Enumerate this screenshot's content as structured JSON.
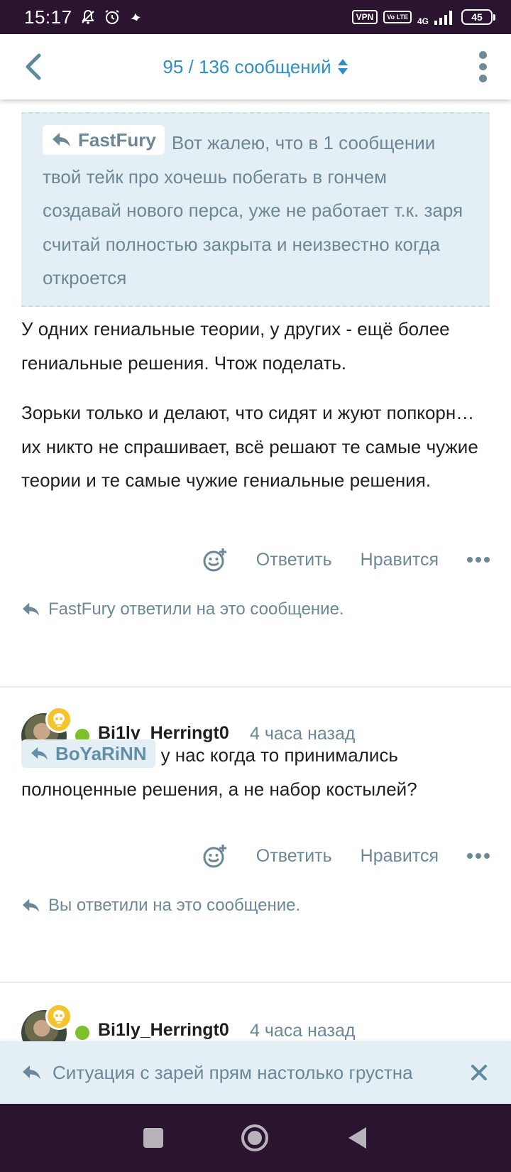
{
  "status_bar": {
    "time": "15:17",
    "vpn": "VPN",
    "volte": "Vo LTE",
    "network": "4G",
    "battery": "45"
  },
  "header": {
    "title": "95 / 136 сообщений"
  },
  "quote": {
    "author": "FastFury",
    "text": "Вот жалею, что в 1 сообщении твой тейк про хочешь побегать в гончем создавай нового перса, уже не работает т.к. заря считай полностью закрыта и неизвестно когда откроется"
  },
  "post1": {
    "para1": "У одних гениальные теории, у других - ещё более гениальные решения. Чтож поделать.",
    "para2": "Зорьки только и делают, что сидят и жуют попкорн… их никто не спрашивает, всё решают те самые чужие теории и те самые чужие гениальные решения.",
    "reply_label": "Ответить",
    "like_label": "Нравится",
    "replied_text": "FastFury ответили на это сообщение."
  },
  "post2": {
    "username": "Bi1ly_Herringt0",
    "time": "4 часа назад",
    "mention": "BoYaRiNN",
    "text": "у нас когда то принимались полноценные решения, а не набор костылей?",
    "reply_label": "Ответить",
    "like_label": "Нравится",
    "replied_text": "Вы ответили на это сообщение."
  },
  "post3": {
    "username": "Bi1ly_Herringt0",
    "time": "4 часа назад"
  },
  "reply_bar": {
    "text": "Ситуация с зарей прям настолько грустна"
  },
  "colors": {
    "accent": "#2d8fc4",
    "quote_bg": "#e3eff5",
    "muted": "#6b8898",
    "online": "#7fbf2e",
    "badge": "#f5c42c",
    "system_bar": "#2a1430"
  }
}
